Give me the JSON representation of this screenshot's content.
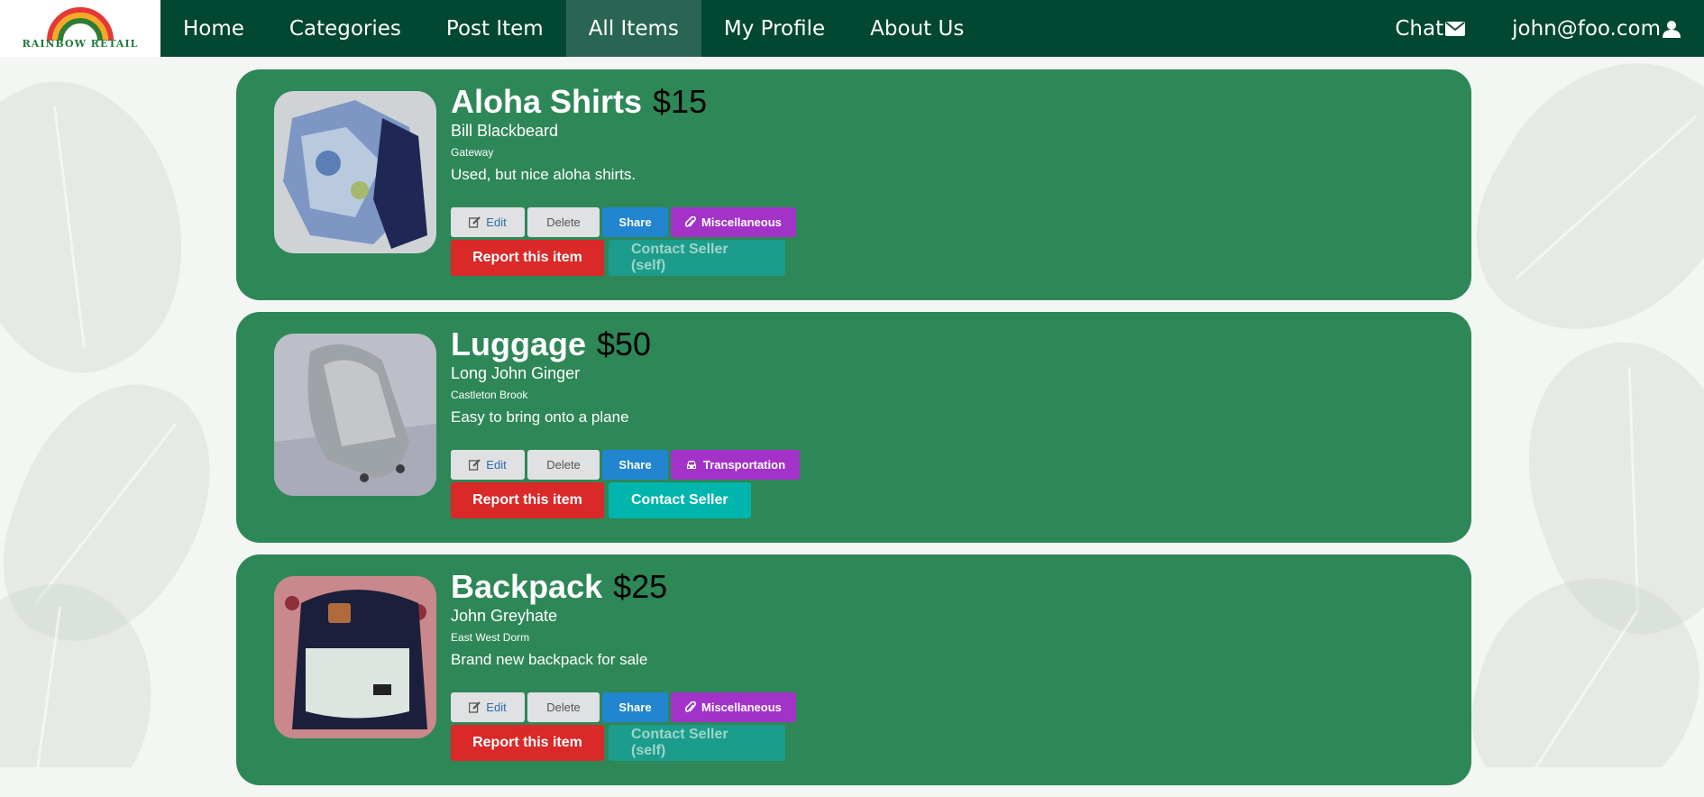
{
  "brand": {
    "name": "RAINBOW RETAIL"
  },
  "nav": {
    "items": [
      {
        "label": "Home"
      },
      {
        "label": "Categories"
      },
      {
        "label": "Post Item"
      },
      {
        "label": "All Items",
        "active": true
      },
      {
        "label": "My Profile"
      },
      {
        "label": "About Us"
      }
    ],
    "chat": "Chat",
    "user": "john@foo.com"
  },
  "buttons": {
    "edit": "Edit",
    "delete": "Delete",
    "share": "Share",
    "report": "Report this item",
    "contact": "Contact Seller",
    "contact_self": "Contact Seller (self)"
  },
  "items": [
    {
      "name": "Aloha Shirts",
      "price": "$15",
      "seller": "Bill Blackbeard",
      "location": "Gateway",
      "description": "Used, but nice aloha shirts.",
      "category": "Miscellaneous",
      "category_icon": "paperclip-icon",
      "contact": "Contact Seller (self)"
    },
    {
      "name": "Luggage",
      "price": "$50",
      "seller": "Long John Ginger",
      "location": "Castleton Brook",
      "description": "Easy to bring onto a plane",
      "category": "Transportation",
      "category_icon": "car-icon",
      "contact": "Contact Seller"
    },
    {
      "name": "Backpack",
      "price": "$25",
      "seller": "John Greyhate",
      "location": "East West Dorm",
      "description": "Brand new backpack for sale",
      "category": "Miscellaneous",
      "category_icon": "paperclip-icon",
      "contact": "Contact Seller (self)"
    }
  ],
  "colors": {
    "nav_bg": "#024731",
    "nav_active": "#2a6553",
    "card_bg": "#2e8757",
    "edit_text": "#2b6cb0",
    "share": "#2185d0",
    "category": "#a333c8",
    "report": "#db2828",
    "contact": "#00b5ad"
  }
}
